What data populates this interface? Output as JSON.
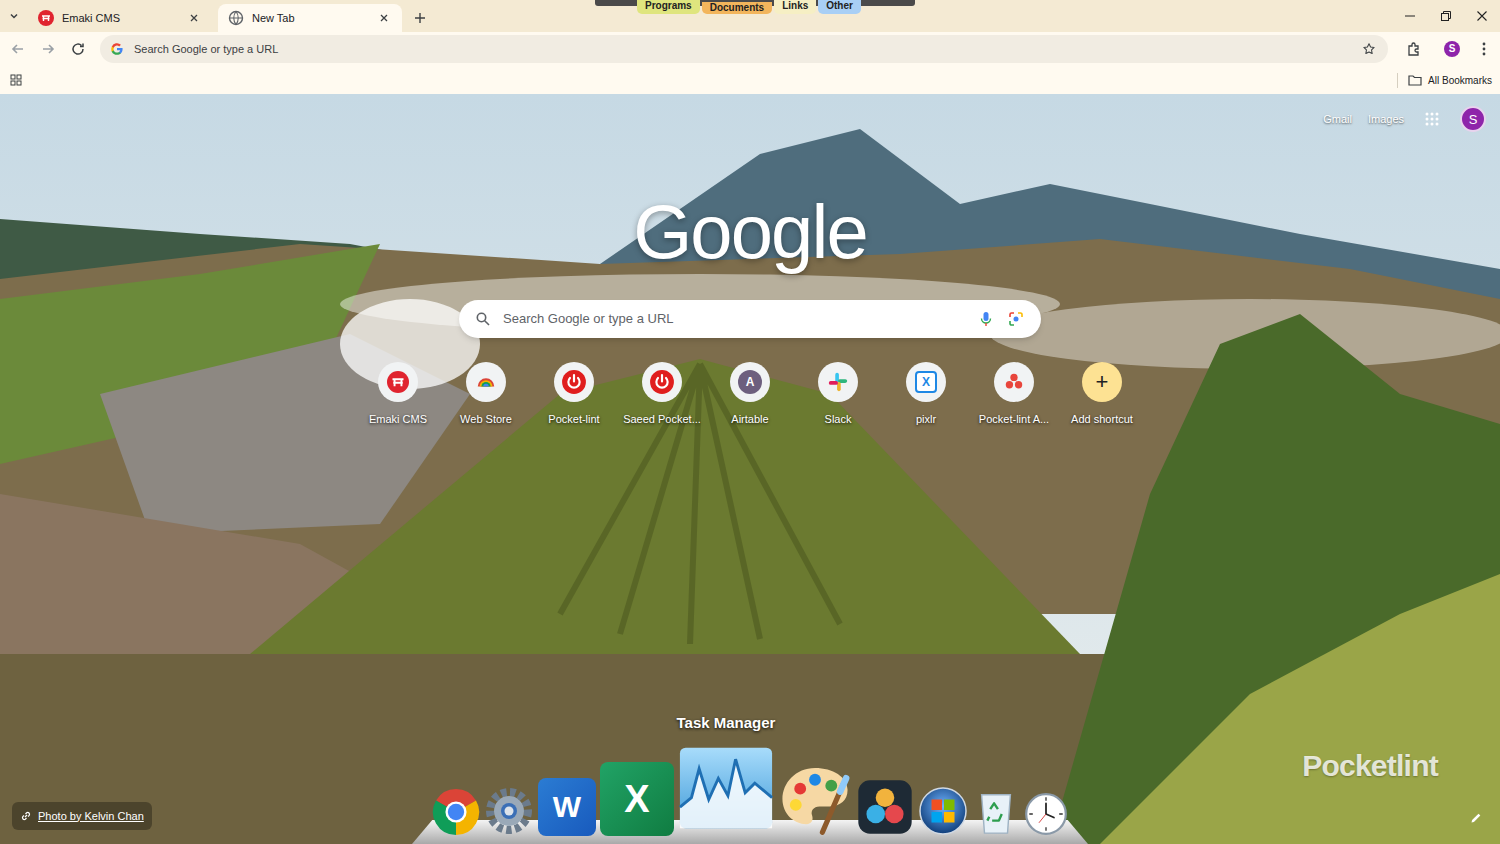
{
  "launcher": {
    "tabs": [
      {
        "label": "Programs",
        "selected": false,
        "color": "#dfe57e"
      },
      {
        "label": "Documents",
        "selected": true,
        "color": "#f2b55c"
      },
      {
        "label": "Links",
        "selected": false,
        "color": "#f6efc4"
      },
      {
        "label": "Other",
        "selected": false,
        "color": "#a8cff5"
      }
    ]
  },
  "browser": {
    "tabs": [
      {
        "label": "Emaki CMS",
        "selected": false,
        "kind": "emaki"
      },
      {
        "label": "New Tab",
        "selected": true,
        "kind": "newtab"
      }
    ],
    "omnibox": {
      "placeholder": "Search Google or type a URL"
    },
    "profile_initial": "S",
    "bookmarks_bar": {
      "all_bookmarks": "All Bookmarks"
    }
  },
  "new_tab_page": {
    "header_links": [
      "Gmail",
      "Images"
    ],
    "account_initial": "S",
    "logo": "Google",
    "search": {
      "placeholder": "Search Google or type a URL"
    },
    "shortcuts": [
      {
        "label": "Emaki CMS",
        "kind": "emaki"
      },
      {
        "label": "Web Store",
        "kind": "webstore"
      },
      {
        "label": "Pocket-lint",
        "kind": "power"
      },
      {
        "label": "Saeed Pocket...",
        "kind": "power"
      },
      {
        "label": "Airtable",
        "kind": "letter",
        "glyph": "A"
      },
      {
        "label": "Slack",
        "kind": "slack"
      },
      {
        "label": "pixlr",
        "kind": "pixlr",
        "glyph": "X"
      },
      {
        "label": "Pocket-lint A...",
        "kind": "dots"
      },
      {
        "label": "Add shortcut",
        "kind": "add",
        "glyph": "+"
      }
    ],
    "photo_credit": "Photo by Kelvin Chan",
    "watermark": "Pocketlint"
  },
  "dock": {
    "tooltip": "Task Manager",
    "items": [
      {
        "kind": "chrome",
        "hovered": false
      },
      {
        "kind": "settings",
        "hovered": false
      },
      {
        "kind": "word",
        "text": "W",
        "hovered": false
      },
      {
        "kind": "excel",
        "text": "X",
        "hovered": false
      },
      {
        "kind": "taskmanager",
        "hovered": true
      },
      {
        "kind": "palette",
        "hovered": false
      },
      {
        "kind": "davinci",
        "hovered": false
      },
      {
        "kind": "windows",
        "hovered": false
      },
      {
        "kind": "recycle",
        "hovered": false
      },
      {
        "kind": "clock",
        "hovered": false
      }
    ]
  }
}
